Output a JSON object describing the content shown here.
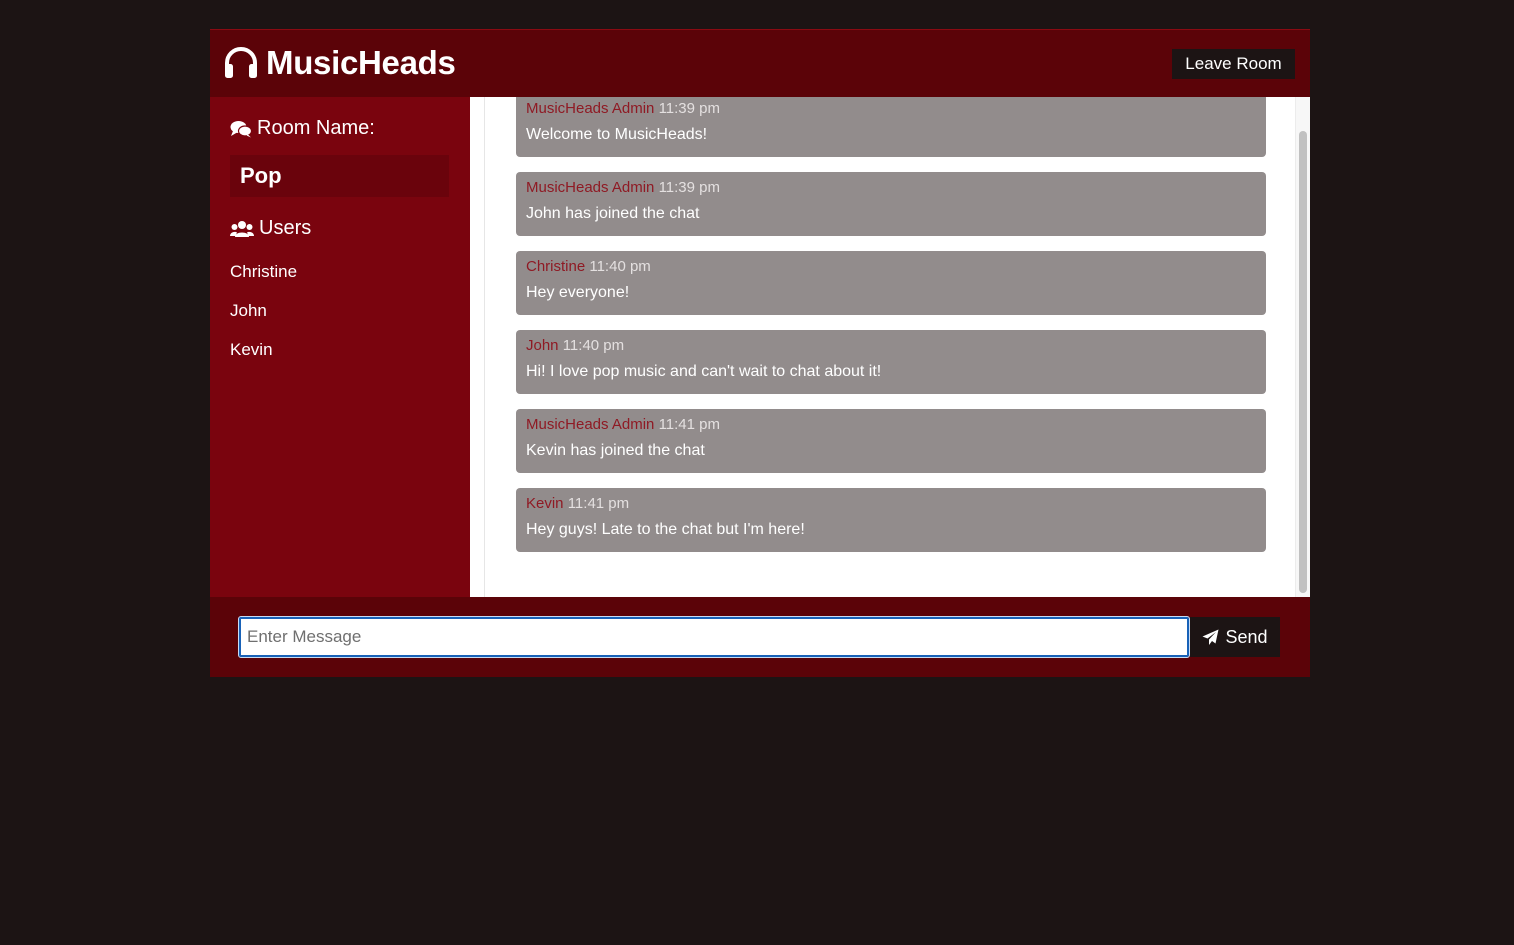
{
  "header": {
    "app_name": "MusicHeads",
    "logo_icon": "headphones-icon",
    "leave_label": "Leave Room"
  },
  "sidebar": {
    "room_heading": "Room Name:",
    "room_icon": "comments-icon",
    "room_name": "Pop",
    "users_heading": "Users",
    "users_icon": "users-icon",
    "users": [
      "Christine",
      "John",
      "Kevin"
    ]
  },
  "messages": [
    {
      "author": "MusicHeads Admin",
      "time": "11:39 pm",
      "text": "Welcome to MusicHeads!"
    },
    {
      "author": "MusicHeads Admin",
      "time": "11:39 pm",
      "text": "John has joined the chat"
    },
    {
      "author": "Christine",
      "time": "11:40 pm",
      "text": "Hey everyone!"
    },
    {
      "author": "John",
      "time": "11:40 pm",
      "text": "Hi! I love pop music and can't wait to chat about it!"
    },
    {
      "author": "MusicHeads Admin",
      "time": "11:41 pm",
      "text": "Kevin has joined the chat"
    },
    {
      "author": "Kevin",
      "time": "11:41 pm",
      "text": "Hey guys! Late to the chat but I'm here!"
    }
  ],
  "form": {
    "placeholder": "Enter Message",
    "value": "",
    "send_label": "Send",
    "send_icon": "paper-plane-icon"
  },
  "colors": {
    "page_background": "#1c1414",
    "header_background": "#5b0308",
    "sidebar_background": "#7a040e",
    "room_name_background": "#6a030c",
    "message_background": "#928c8c",
    "author_color": "#8f1a24",
    "button_background": "#1c1414"
  }
}
